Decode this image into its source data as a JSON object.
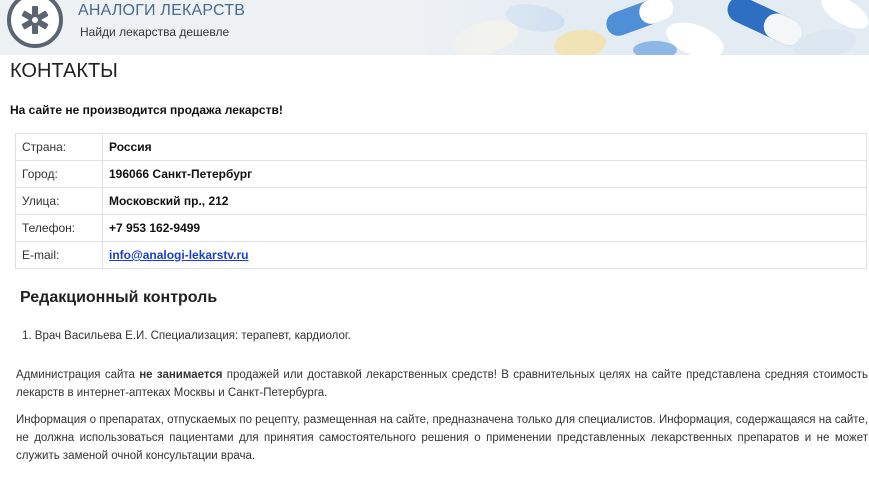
{
  "header": {
    "site_title": "АНАЛОГИ ЛЕКАРСТВ",
    "site_subtitle": "Найди лекарства дешевле",
    "logo_icon": "medical-star-icon",
    "banner_icon": "pills-image"
  },
  "page": {
    "title": "КОНТАКТЫ",
    "notice": "На сайте не производится продажа лекарств!"
  },
  "contacts": [
    {
      "label": "Страна:",
      "value": "Россия"
    },
    {
      "label": "Город:",
      "value": "196066 Санкт-Петербург"
    },
    {
      "label": "Улица:",
      "value": "Московский пр., 212"
    },
    {
      "label": "Телефон:",
      "value": "+7 953 162-9499"
    },
    {
      "label": "E-mail:",
      "value": "info@analogi-lekarstv.ru"
    }
  ],
  "editorial": {
    "title": "Редакционный контроль",
    "doctor": "1. Врач Васильева Е.И. Специализация: терапевт, кардиолог."
  },
  "disclaimer": {
    "p1_start": "Администрация сайта ",
    "p1_bold": "не занимается",
    "p1_end": " продажей или доставкой лекарственных средств! В сравнительных целях на сайте представлена средняя стоимость лекарств в интернет-аптеках Москвы и Санкт-Петербурга.",
    "p2": "Информация о препаратах, отпускаемых по рецепту, размещенная на сайте, предназначена только для специалистов. Информация, содержащаяся на сайте, не должна использоваться пациентами для принятия самостоятельного решения о применении представленных лекарственных препаратов и не может служить заменой очной консультации врача."
  },
  "colors": {
    "link": "#1a3fcc",
    "site_title": "#4b6a8c",
    "header_bg": "#eef1f4"
  }
}
